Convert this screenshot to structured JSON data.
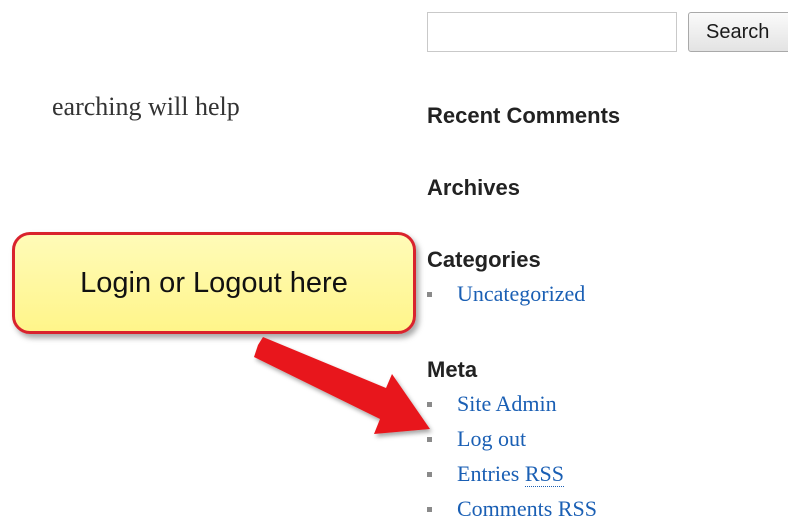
{
  "search": {
    "value": "",
    "placeholder": "",
    "button_label": "Search"
  },
  "content": {
    "fragment": "earching will help"
  },
  "sidebar": {
    "recent_comments_title": "Recent Comments",
    "archives_title": "Archives",
    "categories": {
      "title": "Categories",
      "items": [
        {
          "label": "Uncategorized"
        }
      ]
    },
    "meta": {
      "title": "Meta",
      "items": [
        {
          "label": "Site Admin"
        },
        {
          "label": "Log out"
        },
        {
          "label": "Entries",
          "abbr": "RSS"
        },
        {
          "label": "Comments RSS"
        }
      ]
    }
  },
  "annotation": {
    "callout_text": "Login or Logout here",
    "border_color": "#d9232d",
    "fill_color": "#fff58a",
    "arrow_color": "#e8181c"
  },
  "colors": {
    "link": "#1a5fb4",
    "heading": "#222222",
    "bullet": "#8a8a8a"
  }
}
